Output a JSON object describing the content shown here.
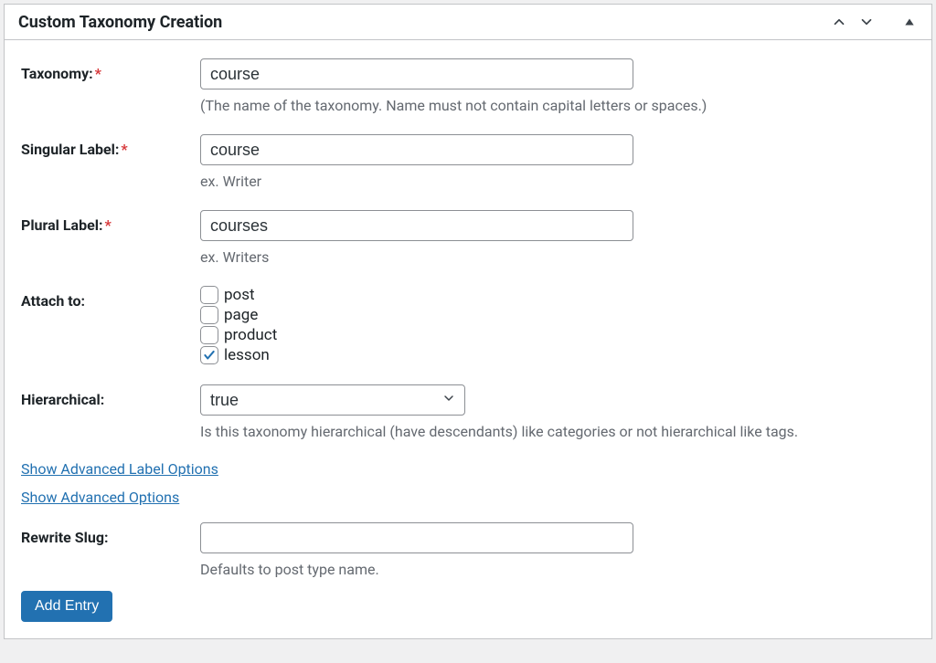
{
  "panel": {
    "title": "Custom Taxonomy Creation"
  },
  "fields": {
    "taxonomy": {
      "label": "Taxonomy:",
      "value": "course",
      "hint": "(The name of the taxonomy. Name must not contain capital letters or spaces.)",
      "required": true
    },
    "singular": {
      "label": "Singular Label:",
      "value": "course",
      "hint": "ex. Writer",
      "required": true
    },
    "plural": {
      "label": "Plural Label:",
      "value": "courses",
      "hint": "ex. Writers",
      "required": true
    },
    "attach": {
      "label": "Attach to:",
      "options": [
        {
          "label": "post",
          "checked": false
        },
        {
          "label": "page",
          "checked": false
        },
        {
          "label": "product",
          "checked": false
        },
        {
          "label": "lesson",
          "checked": true
        }
      ]
    },
    "hierarchical": {
      "label": "Hierarchical:",
      "value": "true",
      "hint": "Is this taxonomy hierarchical (have descendants) like categories or not hierarchical like tags."
    },
    "rewrite": {
      "label": "Rewrite Slug:",
      "value": "",
      "hint": "Defaults to post type name."
    }
  },
  "links": {
    "advanced_labels": "Show Advanced Label Options",
    "advanced_options": "Show Advanced Options"
  },
  "buttons": {
    "submit": "Add Entry"
  },
  "required_marker": "*"
}
